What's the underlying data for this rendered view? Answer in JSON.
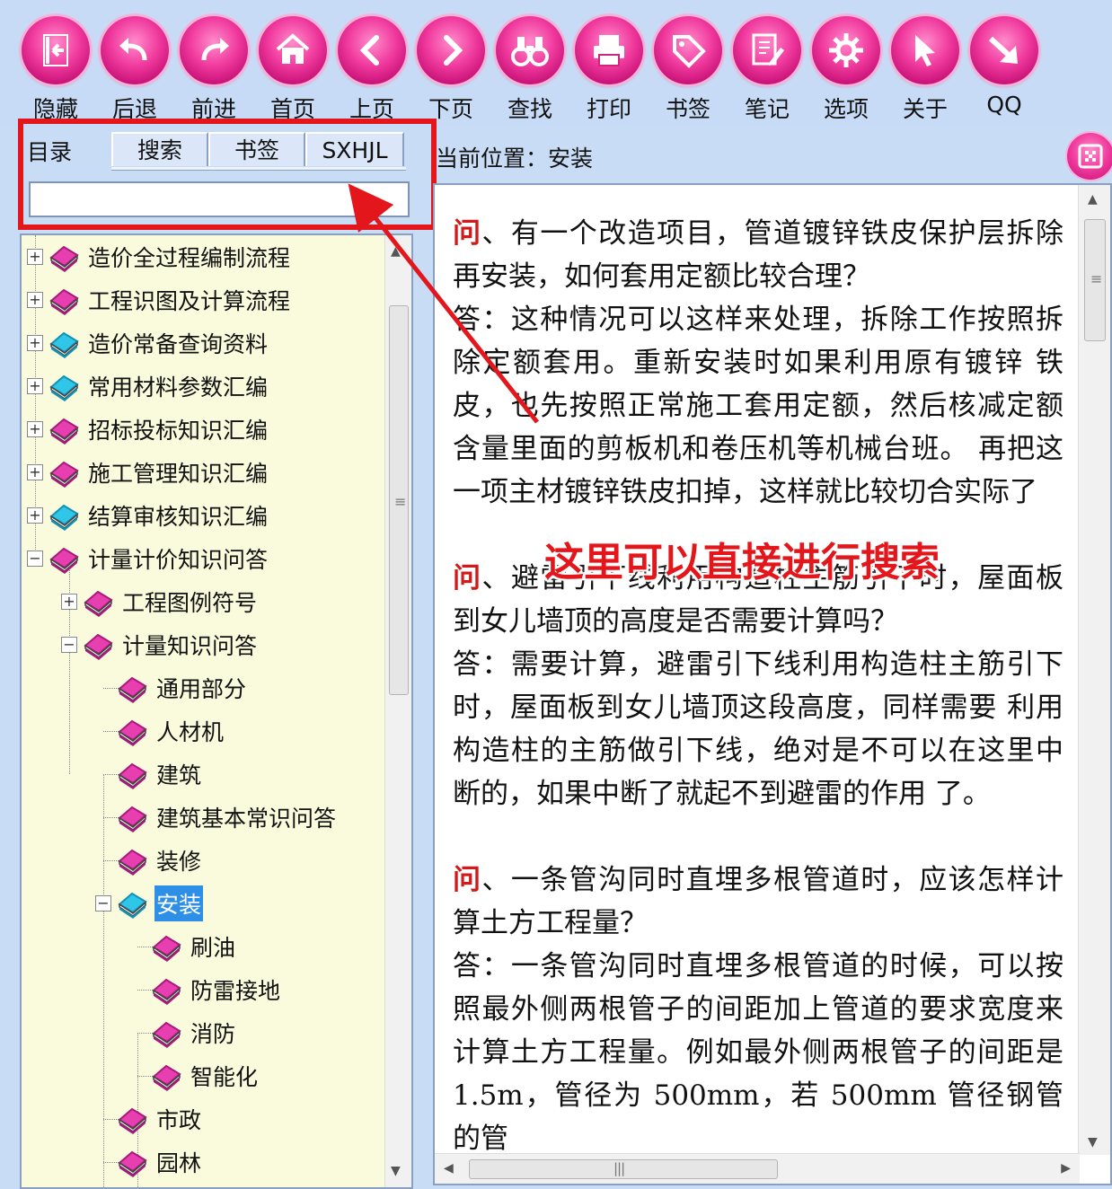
{
  "toolbar": {
    "buttons": [
      {
        "label": "隐藏",
        "icon": "hide-icon"
      },
      {
        "label": "后退",
        "icon": "back-icon"
      },
      {
        "label": "前进",
        "icon": "forward-icon"
      },
      {
        "label": "首页",
        "icon": "home-icon"
      },
      {
        "label": "上页",
        "icon": "prev-page-icon"
      },
      {
        "label": "下页",
        "icon": "next-page-icon"
      },
      {
        "label": "查找",
        "icon": "binoculars-icon"
      },
      {
        "label": "打印",
        "icon": "printer-icon"
      },
      {
        "label": "书签",
        "icon": "bookmark-tag-icon"
      },
      {
        "label": "笔记",
        "icon": "notes-icon"
      },
      {
        "label": "选项",
        "icon": "gear-icon"
      },
      {
        "label": "关于",
        "icon": "cursor-icon"
      },
      {
        "label": "QQ",
        "icon": "qq-arrow-icon"
      }
    ]
  },
  "nav": {
    "catalog_tab": "目录",
    "tabs": [
      "搜索",
      "书签",
      "SXHJL"
    ],
    "search": {
      "value": "",
      "placeholder": ""
    }
  },
  "tree": {
    "items": [
      {
        "label": "造价全过程编制流程",
        "expander": "+",
        "book": "pink"
      },
      {
        "label": "工程识图及计算流程",
        "expander": "+",
        "book": "pink"
      },
      {
        "label": "造价常备查询资料",
        "expander": "+",
        "book": "cyan"
      },
      {
        "label": "常用材料参数汇编",
        "expander": "+",
        "book": "cyan"
      },
      {
        "label": "招标投标知识汇编",
        "expander": "+",
        "book": "pink"
      },
      {
        "label": "施工管理知识汇编",
        "expander": "+",
        "book": "pink"
      },
      {
        "label": "结算审核知识汇编",
        "expander": "+",
        "book": "cyan"
      },
      {
        "label": "计量计价知识问答",
        "expander": "−",
        "book": "pink"
      },
      {
        "label": "工程图例符号",
        "expander": "+",
        "book": "pink"
      },
      {
        "label": "计量知识问答",
        "expander": "−",
        "book": "pink"
      },
      {
        "label": "通用部分",
        "expander": "",
        "book": "pink"
      },
      {
        "label": "人材机",
        "expander": "",
        "book": "pink"
      },
      {
        "label": "建筑",
        "expander": "",
        "book": "pink"
      },
      {
        "label": "建筑基本常识问答",
        "expander": "",
        "book": "pink"
      },
      {
        "label": "装修",
        "expander": "",
        "book": "pink"
      },
      {
        "label": "安装",
        "expander": "−",
        "book": "cyan",
        "selected": true
      },
      {
        "label": "刷油",
        "expander": "",
        "book": "pink"
      },
      {
        "label": "防雷接地",
        "expander": "",
        "book": "pink"
      },
      {
        "label": "消防",
        "expander": "",
        "book": "pink"
      },
      {
        "label": "智能化",
        "expander": "",
        "book": "pink"
      },
      {
        "label": "市政",
        "expander": "",
        "book": "pink"
      },
      {
        "label": "园林",
        "expander": "",
        "book": "pink"
      }
    ]
  },
  "location": {
    "label": "当前位置：",
    "value": "安装"
  },
  "content": {
    "qa": [
      {
        "q_mark": "问",
        "question": "、有一个改造项目，管道镀锌铁皮保护层拆除再安装，如何套用定额比较合理？",
        "answer": "答：这种情况可以这样来处理，拆除工作按照拆除定额套用。重新安装时如果利用原有镀锌 铁皮，也先按照正常施工套用定额，然后核减定额含量里面的剪板机和卷压机等机械台班。 再把这一项主材镀锌铁皮扣掉，这样就比较切合实际了"
      },
      {
        "q_mark": "问",
        "question": "、避雷引下线利用构造柱主筋引下时，屋面板到女儿墙顶的高度是否需要计算吗？",
        "answer": "答：需要计算，避雷引下线利用构造柱主筋引下时，屋面板到女儿墙顶这段高度，同样需要 利用构造柱的主筋做引下线，绝对是不可以在这里中断的，如果中断了就起不到避雷的作用 了。"
      },
      {
        "q_mark": "问",
        "question": "、一条管沟同时直埋多根管道时，应该怎样计算土方工程量？",
        "answer": "答：一条管沟同时直埋多根管道的时候，可以按照最外侧两根管子的间距加上管道的要求宽度来计算土方工程量。例如最外侧两根管子的间距是 1.5m，管径为 500mm，若 500mm 管径钢管的管"
      }
    ]
  },
  "annotation": {
    "caption": "这里可以直接进行搜索",
    "color": "#e3161b"
  },
  "colors": {
    "toolbar_bg": "#c7dbf6",
    "tree_bg": "#fafbdc",
    "button_pink": "#f0399d",
    "selected": "#2e8fe6"
  }
}
